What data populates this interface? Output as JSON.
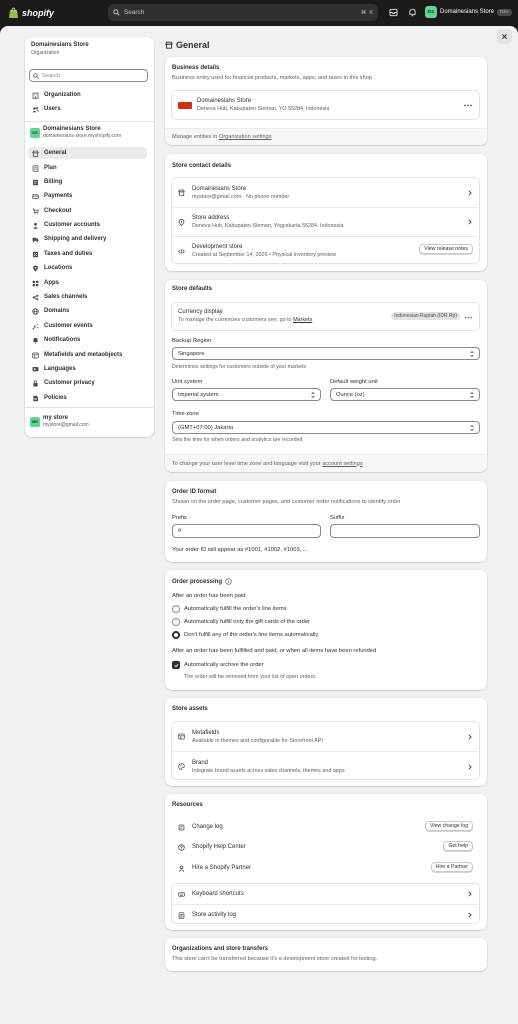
{
  "topbar": {
    "brand": "shopify",
    "search_placeholder": "Search",
    "kbd1": "⌘",
    "kbd2": "K",
    "account_initials": "DS",
    "account_name": "Domainesians Store",
    "account_badge": "Dev"
  },
  "sidebar": {
    "org_name": "Domainesians Store",
    "org_sub": "Organization",
    "search_placeholder": "Search",
    "org_items": [
      {
        "label": "Organization",
        "icon": "building-icon"
      },
      {
        "label": "Users",
        "icon": "users-icon"
      }
    ],
    "store_initials": "DS",
    "store_name": "Domainesians Store",
    "store_domain": "domainesians-store.myshopify.com",
    "items": [
      {
        "label": "General",
        "icon": "store-icon",
        "active": true
      },
      {
        "label": "Plan",
        "icon": "plan-icon"
      },
      {
        "label": "Billing",
        "icon": "billing-icon"
      },
      {
        "label": "Payments",
        "icon": "payments-icon"
      },
      {
        "label": "Checkout",
        "icon": "cart-icon"
      },
      {
        "label": "Customer accounts",
        "icon": "person-icon"
      },
      {
        "label": "Shipping and delivery",
        "icon": "truck-icon"
      },
      {
        "label": "Taxes and duties",
        "icon": "tax-icon"
      },
      {
        "label": "Locations",
        "icon": "location-icon"
      },
      {
        "label": "Apps",
        "icon": "apps-icon"
      },
      {
        "label": "Sales channels",
        "icon": "channels-icon"
      },
      {
        "label": "Domains",
        "icon": "globe-icon"
      },
      {
        "label": "Customer events",
        "icon": "events-icon"
      },
      {
        "label": "Notifications",
        "icon": "bell-icon"
      },
      {
        "label": "Metafields and metaobjects",
        "icon": "metafields-icon"
      },
      {
        "label": "Languages",
        "icon": "language-icon"
      },
      {
        "label": "Customer privacy",
        "icon": "privacy-icon"
      },
      {
        "label": "Policies",
        "icon": "policies-icon"
      }
    ],
    "user_initials": "MS",
    "user_name": "my store",
    "user_email": "mystore@gmail.com"
  },
  "page": {
    "title": "General"
  },
  "business": {
    "title": "Business details",
    "subtitle": "Business entity used for financial products, markets, apps, and taxes in this shop",
    "entity_name": "Domainesians Store",
    "entity_address": "Deneva Hub, Kabupaten Sleman, YO 55284, Indonesia",
    "footer_prefix": "Manage entities in ",
    "footer_link": "Organization settings"
  },
  "contact": {
    "title": "Store contact details",
    "store_name": "Domainesians Store",
    "store_email": "mystore@gmail.com · No phone number",
    "address_title": "Store address",
    "address": "Deneva Hub, Kabupaten Sleman, Yogyakarta 55284, Indonesia",
    "dev_title": "Development store",
    "dev_desc": "Created at September 14, 2026 • Physical inventory preview",
    "release_button": "View release notes"
  },
  "defaults": {
    "title": "Store defaults",
    "currency_title": "Currency display",
    "currency_desc_prefix": "To manage the currencies customers see, go to ",
    "currency_link": "Markets",
    "currency_badge": "Indonesian Rupiah (IDR Rp)",
    "backup_label": "Backup Region",
    "backup_value": "Singapore",
    "backup_hint": "Determines settings for customers outside of your markets",
    "unit_label": "Unit system",
    "unit_value": "Imperial system",
    "weight_label": "Default weight unit",
    "weight_value": "Ounce (oz)",
    "tz_label": "Time zone",
    "tz_value": "(GMT+07:00) Jakarta",
    "tz_hint": "Sets the time for when orders and analytics are recorded",
    "footer_prefix": "To change your user level time zone and language visit your ",
    "footer_link": "account settings"
  },
  "order_id": {
    "title": "Order ID format",
    "subtitle": "Shown on the order page, customer pages, and customer order notifications to identify order",
    "prefix_label": "Prefix",
    "prefix_value": "#",
    "suffix_label": "Suffix",
    "suffix_value": "",
    "preview": "Your order ID will appear as #1001, #1002, #1003, ..."
  },
  "processing": {
    "title": "Order processing",
    "paid_label": "After an order has been paid",
    "options": [
      {
        "label": "Automatically fulfill the order's line items",
        "selected": false
      },
      {
        "label": "Automatically fulfill only the gift cards of the order",
        "selected": false
      },
      {
        "label": "Don't fulfill any of the order's line items automatically",
        "selected": true
      }
    ],
    "fulfilled_label": "After an order has been fulfilled and paid, or when all items have been refunded",
    "archive_label": "Automatically archive the order",
    "archive_desc": "The order will be removed from your list of open orders."
  },
  "assets": {
    "title": "Store assets",
    "metafields_title": "Metafields",
    "metafields_desc": "Available in themes and configurable for Storefront API",
    "brand_title": "Brand",
    "brand_desc": "Integrate brand assets across sales channels, themes and apps"
  },
  "resources": {
    "title": "Resources",
    "items": [
      {
        "label": "Change log",
        "button": "View change log"
      },
      {
        "label": "Shopify Help Center",
        "button": "Get help"
      },
      {
        "label": "Hire a Shopify Partner",
        "button": "Hire a Partner"
      }
    ],
    "shortcuts": "Keyboard shortcuts",
    "activity": "Store activity log"
  },
  "transfers": {
    "title": "Organizations and store transfers",
    "desc": "This store can't be transferred because it's a development store created for testing."
  },
  "colors": {
    "accent_green": "#5fd68f",
    "topbar": "#1a1a1a",
    "page_bg": "#f1f1f1",
    "flag_red": "#d72c0d"
  }
}
